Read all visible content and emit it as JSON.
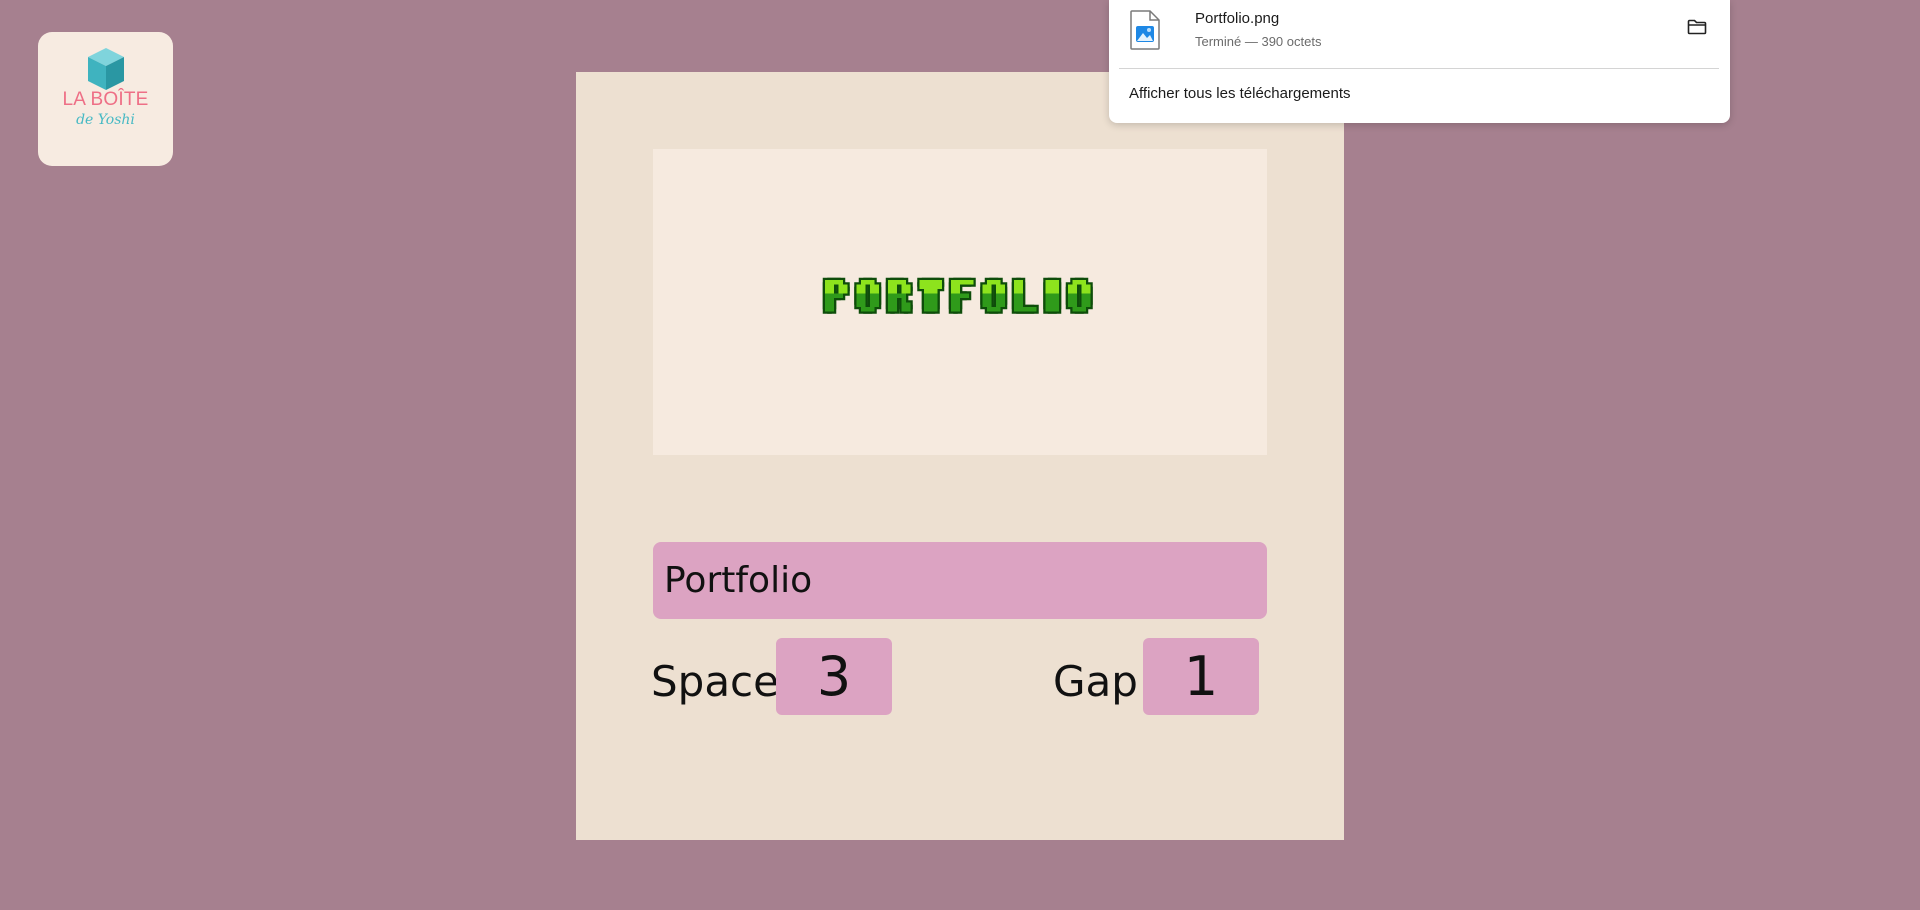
{
  "logo": {
    "brand": "LA BOÎTE",
    "sub": "de Yoshi",
    "brand_color": "#ee6f86",
    "cube_color": "#47b9c4"
  },
  "preview": {
    "rendered_text": "PORTFOLIO",
    "letter_color_dark": "#0e4d0a",
    "letter_color_mid": "#2f9a1a",
    "letter_color_light": "#8de31d"
  },
  "form": {
    "text_value": "Portfolio",
    "space_label": "Space",
    "space_value": "3",
    "gap_label": "Gap",
    "gap_value": "1"
  },
  "downloads": {
    "file_name": "Portfolio.png",
    "status": "Terminé — 390 octets",
    "show_all_label": "Afficher tous les téléchargements",
    "file_icon": "image-file-icon",
    "folder_icon": "folder-icon"
  },
  "colors": {
    "background": "#a6808f",
    "card": "#ede0d1",
    "field": "#dca3c2"
  }
}
